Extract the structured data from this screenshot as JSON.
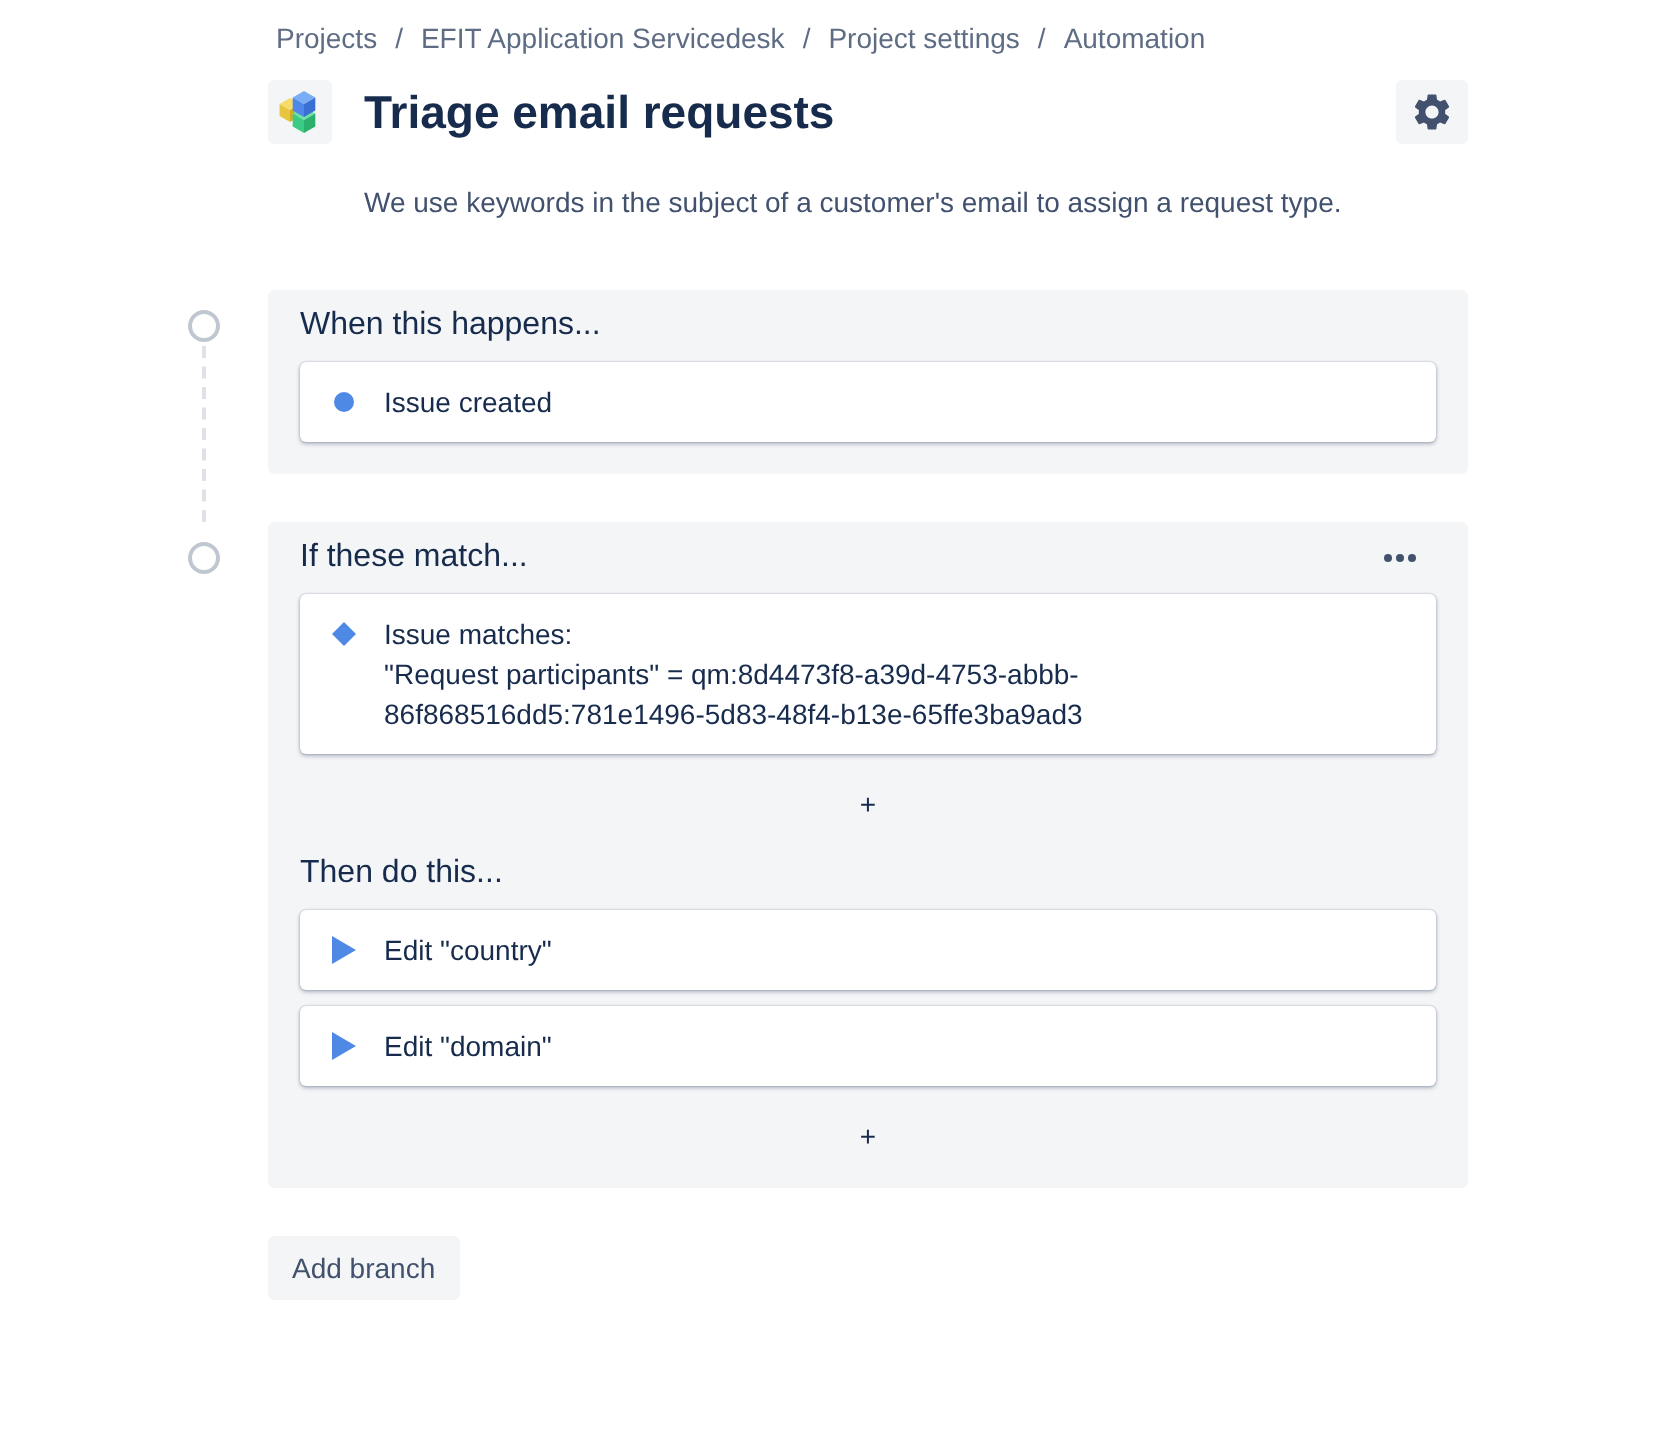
{
  "breadcrumbs": [
    {
      "label": "Projects"
    },
    {
      "separator": "/",
      "label": "EFIT Application Servicedesk"
    },
    {
      "separator": "/",
      "label": "Project settings"
    },
    {
      "separator": "/",
      "label": "Automation"
    }
  ],
  "rule": {
    "title": "Triage email requests",
    "description": "We use keywords in the subject of a customer's email to assign a request type."
  },
  "sections": [
    {
      "heading": "When this happens...",
      "more_menu": false,
      "blocks": [
        {
          "kind": "trigger",
          "lines": [
            "Issue created"
          ]
        }
      ]
    },
    {
      "heading": "If these match...",
      "more_menu": true,
      "blocks": [
        {
          "kind": "condition",
          "lines": [
            "Issue matches:",
            "\"Request participants\" = qm:8d4473f8-a39d-4753-abbb-86f868516dd5:781e1496-5d83-48f4-b13e-65ffe3ba9ad3"
          ]
        },
        {
          "kind": "add",
          "label": "+"
        },
        {
          "kind": "subheading",
          "text": "Then do this..."
        },
        {
          "kind": "action",
          "lines": [
            "Edit \"country\""
          ]
        },
        {
          "kind": "action",
          "lines": [
            "Edit \"domain\""
          ]
        },
        {
          "kind": "add",
          "label": "+"
        }
      ]
    }
  ],
  "add_branch_button": "Add branch"
}
